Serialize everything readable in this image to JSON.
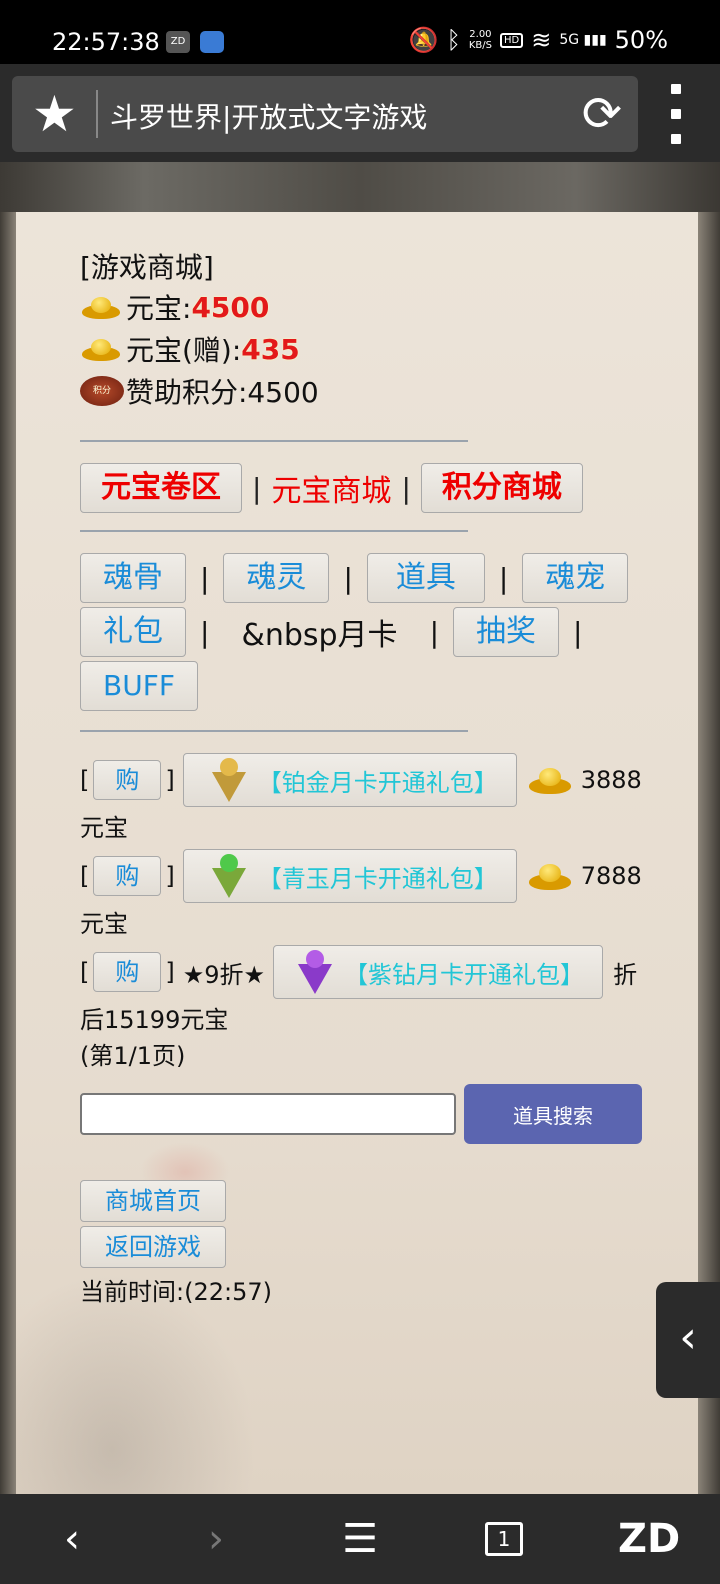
{
  "status_bar": {
    "time": "22:57:38",
    "app_icon_1": "ZD",
    "speed": "2.00\nKB/S",
    "hd": "HD",
    "network": "5G",
    "battery": "50%"
  },
  "browser": {
    "page_title": "斗罗世界|开放式文字游戏",
    "star_icon": "★",
    "reload_icon": "⟳"
  },
  "shop": {
    "header": "[游戏商城]",
    "yuanbao_label": "元宝:",
    "yuanbao_value": "4500",
    "yuanbao_gift_label": "元宝(赠):",
    "yuanbao_gift_value": "435",
    "sponsor_label": "赞助积分:4500",
    "sponsor_badge": "积分"
  },
  "tabs": {
    "coupon": "元宝卷区",
    "sep1": "|",
    "yuanbao_shop": "元宝商城",
    "sep2": "|",
    "points_shop": "积分商城"
  },
  "categories": {
    "soul_bone": "魂骨",
    "soul_spirit": "魂灵",
    "props": "道具",
    "soul_pet": "魂宠",
    "gift": "礼包",
    "monthly": "&nbsp月卡",
    "lottery": "抽奖",
    "buff": "BUFF",
    "sep": "|"
  },
  "items": [
    {
      "bracket_open": "[",
      "buy": "购",
      "bracket_close": "]",
      "name": "【铂金月卡开通礼包】",
      "price": "3888",
      "unit": "元宝"
    },
    {
      "bracket_open": "[",
      "buy": "购",
      "bracket_close": "]",
      "name": "【青玉月卡开通礼包】",
      "price": "7888",
      "unit": "元宝"
    },
    {
      "bracket_open": "[",
      "buy": "购",
      "bracket_close": "]",
      "discount": "★9折★",
      "name": "【紫钻月卡开通礼包】",
      "price_prefix": "折",
      "price_suffix": "后15199元宝"
    }
  ],
  "pagination": "(第1/1页)",
  "search": {
    "placeholder": "",
    "button": "道具搜索"
  },
  "nav": {
    "shop_home": "商城首页",
    "back_to_game": "返回游戏",
    "current_time": "当前时间:(22:57)"
  },
  "bottom_bar": {
    "tab_count": "1",
    "brand": "ZD"
  },
  "colors": {
    "accent_red": "#e31a1a",
    "link_blue": "#1a8cd8",
    "package_cyan": "#22c6d6",
    "search_button": "#5b65b0"
  }
}
